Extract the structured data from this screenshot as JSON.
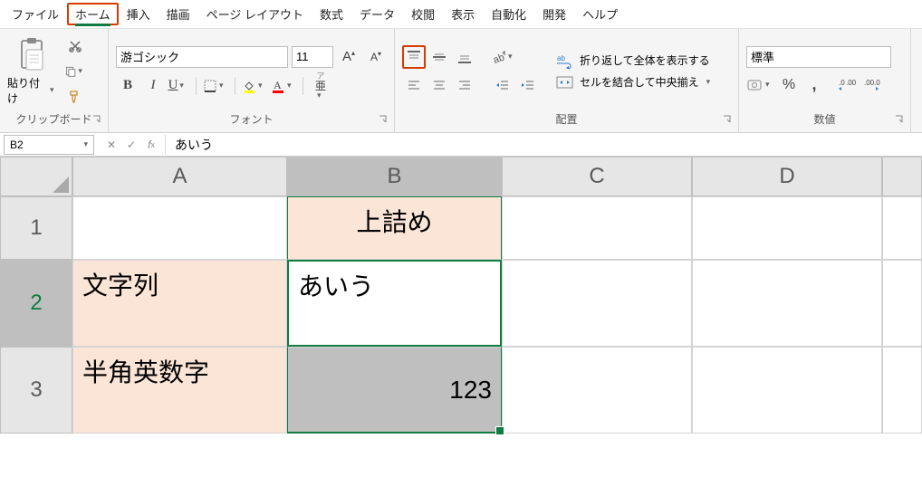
{
  "menu": {
    "file": "ファイル",
    "home": "ホーム",
    "insert": "挿入",
    "draw": "描画",
    "layout": "ページ レイアウト",
    "formulas": "数式",
    "data": "データ",
    "review": "校閲",
    "view": "表示",
    "automate": "自動化",
    "developer": "開発",
    "help": "ヘルプ"
  },
  "ribbon": {
    "clipboard": {
      "paste": "貼り付け",
      "group": "クリップボード"
    },
    "font": {
      "name": "游ゴシック",
      "size": "11",
      "group": "フォント"
    },
    "align": {
      "wrap": "折り返して全体を表示する",
      "merge": "セルを結合して中央揃え",
      "group": "配置"
    },
    "number": {
      "format": "標準",
      "group": "数値"
    }
  },
  "fbar": {
    "name": "B2",
    "value": "あいう"
  },
  "cols": {
    "A": "A",
    "B": "B",
    "C": "C",
    "D": "D"
  },
  "rows": {
    "r1": "1",
    "r2": "2",
    "r3": "3"
  },
  "cells": {
    "B1": "上詰め",
    "A2": "文字列",
    "B2": "あいう",
    "A3": "半角英数字",
    "B3": "123"
  }
}
